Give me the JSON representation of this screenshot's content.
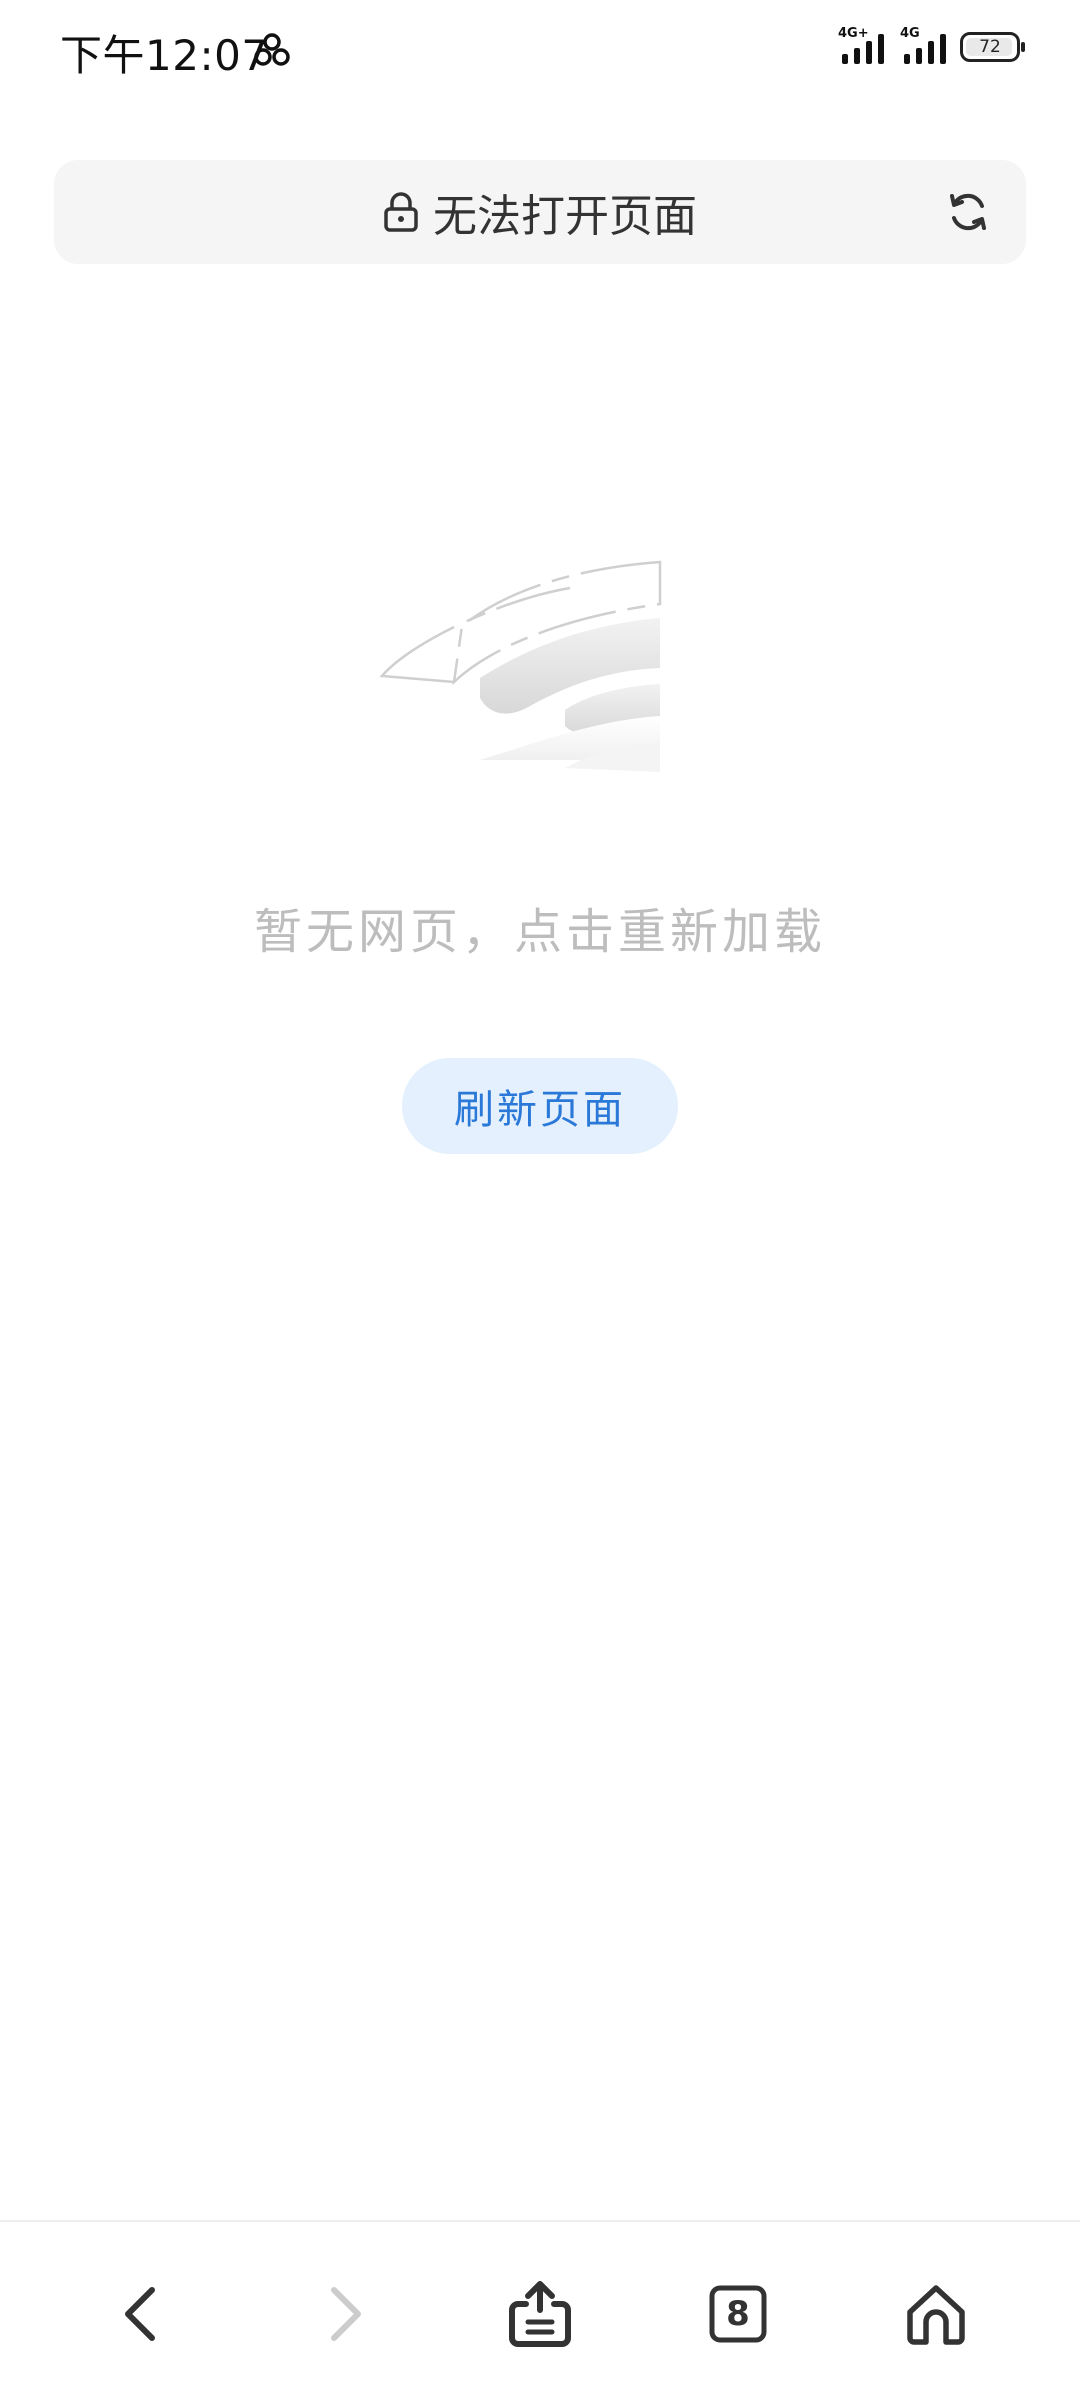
{
  "status_bar": {
    "time": "下午12:07",
    "signal_1_tag": "4G+",
    "signal_2_tag": "4G",
    "battery": "72",
    "app_icon": "cluster-icon"
  },
  "address_bar": {
    "title": "无法打开页面",
    "lock_icon": "lock-icon",
    "reload_icon": "reload-icon"
  },
  "empty_state": {
    "illustration": "no-network-wifi-illustration",
    "message": "暂无网页，点击重新加载",
    "refresh_label": "刷新页面"
  },
  "toolbar": {
    "back_icon": "back-arrow-icon",
    "forward_icon": "forward-arrow-icon",
    "share_icon": "share-icon",
    "tabs_count": "8",
    "home_icon": "home-icon"
  },
  "colors": {
    "accent": "#2a78d8",
    "button_bg": "#e4f0fd",
    "address_bg": "#f5f5f5",
    "muted_text": "#bdbdbd",
    "disabled_icon": "#cccccc"
  }
}
